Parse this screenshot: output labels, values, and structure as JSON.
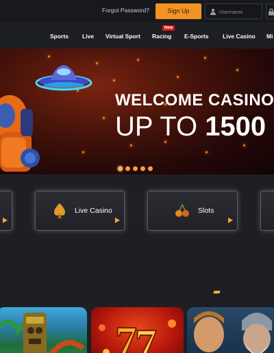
{
  "header": {
    "forgot_password": "Forgot Password?",
    "signup_label": "Sign Up",
    "username_placeholder": "Username"
  },
  "nav": {
    "items": [
      "Sports",
      "Live",
      "Virtual Sport",
      "Racing",
      "E-Sports",
      "Live Casino",
      "Mi"
    ],
    "racing_badge": "New"
  },
  "banner": {
    "line1": "WELCOME CASINO",
    "line2_prefix": "UP TO",
    "line2_amount": "1500",
    "slide_count": 5,
    "active_slide": 1
  },
  "categories": [
    {
      "label": "Live Casino",
      "icon": "spade-icon"
    },
    {
      "label": "Slots",
      "icon": "cherry-icon"
    }
  ],
  "games": [
    {
      "icon": "tiki-game-thumbnail"
    },
    {
      "icon": "lucky-seven-game-thumbnail"
    },
    {
      "icon": "vikings-game-thumbnail"
    }
  ],
  "colors": {
    "accent": "#f39321",
    "badge": "#e0161c",
    "background": "#1d1f24"
  }
}
